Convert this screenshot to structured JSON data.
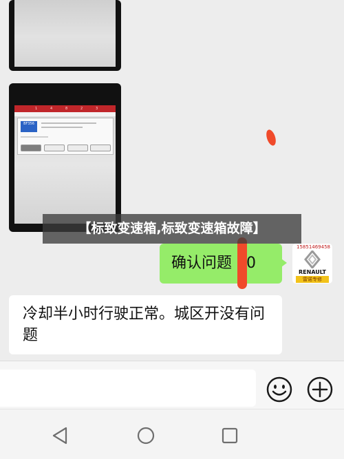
{
  "banner": {
    "title": "【标致变速箱,标致变速箱故障】"
  },
  "messages": {
    "outgoing": {
      "text": "确认问题 00"
    },
    "incoming": {
      "text": "冷却半小时行驶正常。城区开没有问题"
    }
  },
  "avatar": {
    "phone": "15851469458",
    "brand": "RENAULT",
    "shop": "雷诺专修"
  },
  "tablet": {
    "top_labels": [
      "1",
      "4",
      "8",
      "2",
      "3"
    ],
    "card_badge": "BF356"
  },
  "input_bar": {
    "emoji_icon": "emoji-icon",
    "plus_icon": "plus-icon"
  },
  "nav_bar": {
    "back_icon": "back-triangle-icon",
    "home_icon": "home-circle-icon",
    "recents_icon": "recents-square-icon"
  },
  "colors": {
    "outgoing_bubble": "#95ec69",
    "incoming_bubble": "#ffffff",
    "background": "#ededed",
    "banner_bg": "#3c3c3c",
    "accent_red": "#f04a2a"
  }
}
